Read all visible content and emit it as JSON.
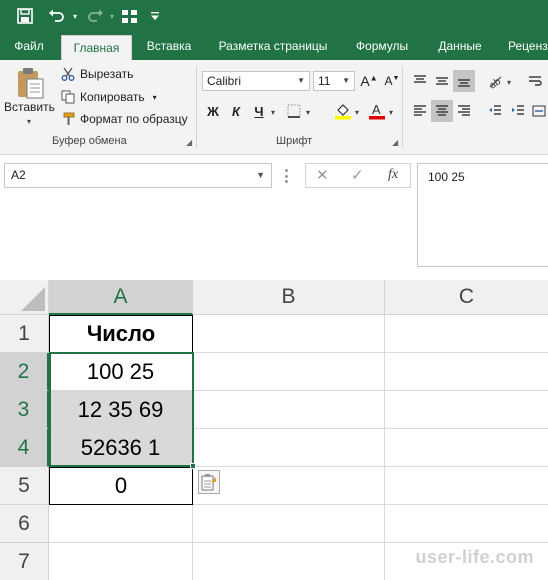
{
  "theme": {
    "accent": "#217346",
    "selection_fill": "#d9d9d9"
  },
  "qat": {
    "save_icon": "save-icon",
    "undo_icon": "undo-icon",
    "redo_icon": "redo-icon",
    "form_icon": "form-icon",
    "customize_icon": "customize-qat-icon"
  },
  "tabs": [
    {
      "label": "Файл"
    },
    {
      "label": "Главная",
      "active": true
    },
    {
      "label": "Вставка"
    },
    {
      "label": "Разметка страницы"
    },
    {
      "label": "Формулы"
    },
    {
      "label": "Данные"
    },
    {
      "label": "Реценз"
    }
  ],
  "clipboard": {
    "paste_label": "Вставить",
    "cut_label": "Вырезать",
    "copy_label": "Копировать",
    "format_painter_label": "Формат по образцу",
    "group_label": "Буфер обмена"
  },
  "font": {
    "name": "Calibri",
    "size": "11",
    "bold": "Ж",
    "italic": "К",
    "underline": "Ч",
    "group_label": "Шрифт",
    "fill_color": "#ffff00",
    "font_color": "#e00000"
  },
  "formula_bar": {
    "name_box": "A2",
    "cancel": "✕",
    "enter": "✓",
    "fx": "fx",
    "content": "100 25"
  },
  "sheet": {
    "columns": [
      "A",
      "B",
      "C"
    ],
    "rows": [
      "1",
      "2",
      "3",
      "4",
      "5",
      "6",
      "7"
    ],
    "cells": {
      "A1": "Число",
      "A2": "100 25",
      "A3": "12 35 69",
      "A4": "52636 1",
      "A5": "0"
    }
  },
  "watermark": "user-life.com"
}
